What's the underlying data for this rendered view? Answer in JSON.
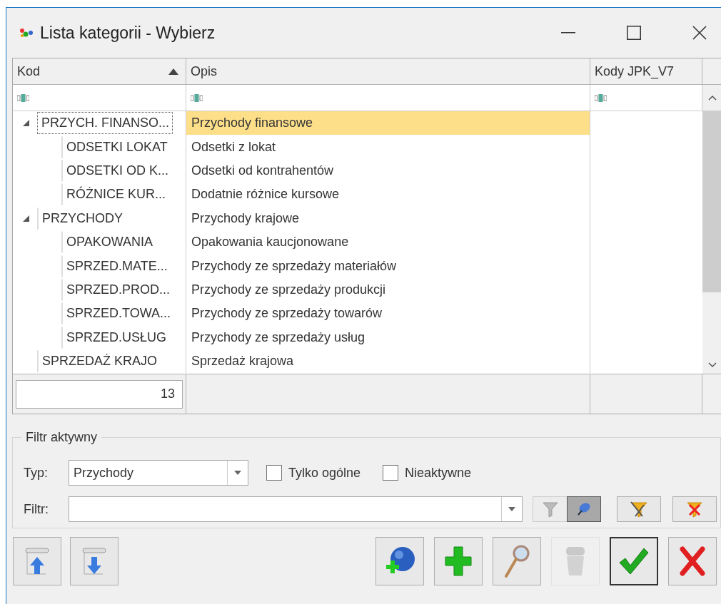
{
  "window": {
    "title": "Lista kategorii - Wybierz"
  },
  "table": {
    "columns": [
      {
        "label": "Kod",
        "sorted": true
      },
      {
        "label": "Opis",
        "sorted": false
      },
      {
        "label": "Kody JPK_V7",
        "sorted": false
      }
    ],
    "rows": [
      {
        "code": "PRZYCH. FINANSO...",
        "description": "Przychody finansowe",
        "selected": true,
        "expanded": true,
        "children": [
          {
            "code": "ODSETKI LOKAT",
            "description": "Odsetki z lokat",
            "selected": false
          },
          {
            "code": "ODSETKI OD K...",
            "description": "Odsetki od kontrahentów",
            "selected": false
          },
          {
            "code": "RÓŻNICE KUR...",
            "description": "Dodatnie różnice kursowe",
            "selected": false
          }
        ]
      },
      {
        "code": "PRZYCHODY",
        "description": "Przychody krajowe",
        "selected": false,
        "expanded": true,
        "children": [
          {
            "code": "OPAKOWANIA",
            "description": "Opakowania kaucjonowane",
            "selected": false
          },
          {
            "code": "SPRZED.MATE...",
            "description": "Przychody ze sprzedaży materiałów",
            "selected": false
          },
          {
            "code": "SPRZED.PROD...",
            "description": "Przychody ze sprzedaży produkcji",
            "selected": false
          },
          {
            "code": "SPRZED.TOWA...",
            "description": "Przychody ze sprzedaży towarów",
            "selected": false
          },
          {
            "code": "SPRZED.USŁUG",
            "description": "Przychody ze sprzedaży usług",
            "selected": false
          }
        ]
      },
      {
        "code": "SPRZEDAŻ KRAJO",
        "description": "Sprzedaż krajowa",
        "selected": false
      }
    ],
    "count": "13"
  },
  "filter_group": {
    "title": "Filtr aktywny",
    "type_label": "Typ:",
    "type_value": "Przychody",
    "checkboxes": [
      {
        "label": "Tylko ogólne",
        "checked": false
      },
      {
        "label": "Nieaktywne",
        "checked": false
      }
    ],
    "filter_label": "Filtr:",
    "filter_buttons": [
      {
        "kind": "funnel",
        "selected": false
      },
      {
        "kind": "pin",
        "selected": true
      },
      {
        "kind": "funnel-tools",
        "selected": false
      },
      {
        "kind": "funnel-clear",
        "selected": false
      }
    ]
  },
  "actions": {
    "left": [
      {
        "kind": "up",
        "disabled": false
      },
      {
        "kind": "down",
        "disabled": false
      }
    ],
    "right": [
      {
        "kind": "globe-add",
        "disabled": false
      },
      {
        "kind": "add",
        "disabled": false
      },
      {
        "kind": "search",
        "disabled": false
      },
      {
        "kind": "trash",
        "disabled": true
      },
      {
        "kind": "ok",
        "disabled": false
      },
      {
        "kind": "cancel",
        "disabled": false
      }
    ]
  }
}
